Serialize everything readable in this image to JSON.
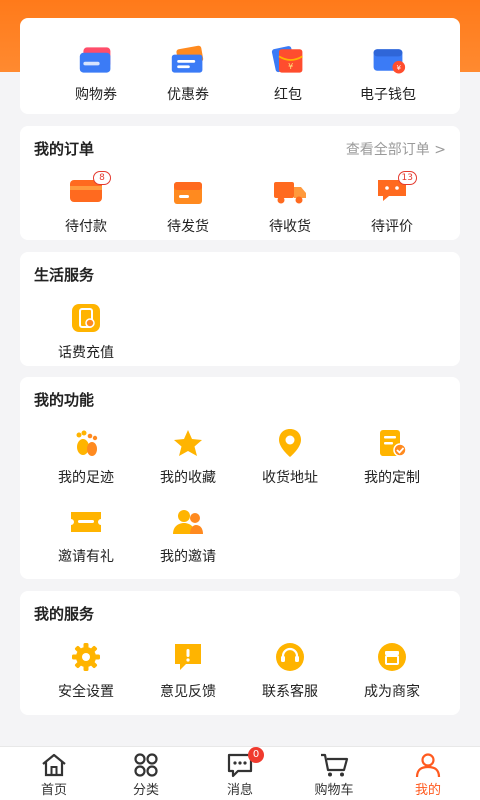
{
  "wallet": {
    "items": [
      {
        "label": "购物券",
        "icon": "shopping-voucher-icon"
      },
      {
        "label": "优惠券",
        "icon": "coupon-icon"
      },
      {
        "label": "红包",
        "icon": "red-packet-icon"
      },
      {
        "label": "电子钱包",
        "icon": "e-wallet-icon"
      }
    ]
  },
  "orders": {
    "title": "我的订单",
    "view_all": "查看全部订单 >",
    "items": [
      {
        "label": "待付款",
        "icon": "pending-payment-icon",
        "badge": "8"
      },
      {
        "label": "待发货",
        "icon": "pending-shipment-icon"
      },
      {
        "label": "待收货",
        "icon": "pending-receipt-icon"
      },
      {
        "label": "待评价",
        "icon": "pending-review-icon",
        "badge": "13"
      }
    ]
  },
  "life": {
    "title": "生活服务",
    "items": [
      {
        "label": "话费充值",
        "icon": "phone-recharge-icon"
      }
    ]
  },
  "functions": {
    "title": "我的功能",
    "items": [
      {
        "label": "我的足迹",
        "icon": "footprint-icon"
      },
      {
        "label": "我的收藏",
        "icon": "star-icon"
      },
      {
        "label": "收货地址",
        "icon": "location-pin-icon"
      },
      {
        "label": "我的定制",
        "icon": "custom-document-icon"
      },
      {
        "label": "邀请有礼",
        "icon": "invite-ticket-icon"
      },
      {
        "label": "我的邀请",
        "icon": "users-icon"
      }
    ]
  },
  "services": {
    "title": "我的服务",
    "items": [
      {
        "label": "安全设置",
        "icon": "gear-icon"
      },
      {
        "label": "意见反馈",
        "icon": "feedback-icon"
      },
      {
        "label": "联系客服",
        "icon": "customer-service-icon"
      },
      {
        "label": "成为商家",
        "icon": "store-icon"
      }
    ]
  },
  "nav": {
    "items": [
      {
        "label": "首页",
        "icon": "home-icon"
      },
      {
        "label": "分类",
        "icon": "category-grid-icon"
      },
      {
        "label": "消息",
        "icon": "message-icon",
        "badge": "0"
      },
      {
        "label": "购物车",
        "icon": "cart-icon"
      },
      {
        "label": "我的",
        "icon": "user-icon",
        "active": true
      }
    ]
  },
  "colors": {
    "accent": "#ff7a1a",
    "icon_orange": "#ff8a1f",
    "icon_yellow": "#ffb400",
    "active_nav": "#ff5a1f",
    "badge_red": "#e43a2f"
  }
}
